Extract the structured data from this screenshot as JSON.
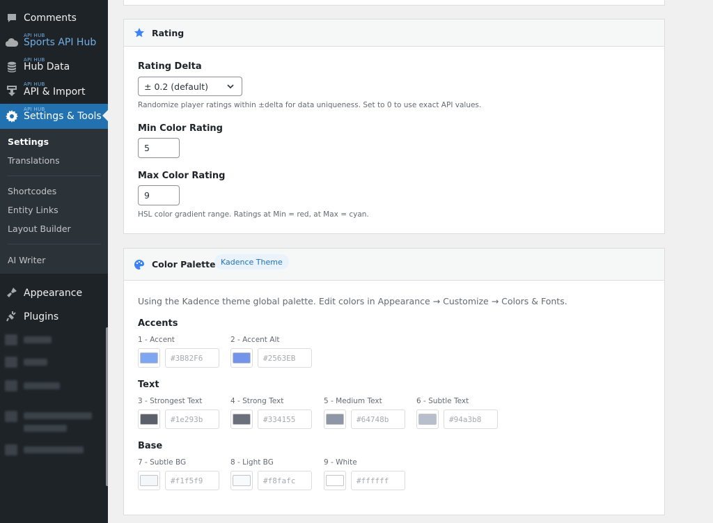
{
  "sidebar": {
    "menu": [
      {
        "label": "Comments",
        "sup": ""
      },
      {
        "label": "Sports API Hub",
        "sup": "API HUB"
      },
      {
        "label": "Hub Data",
        "sup": "API HUB"
      },
      {
        "label": "API & Import",
        "sup": "API HUB"
      },
      {
        "label": "Settings & Tools",
        "sup": "API HUB"
      }
    ],
    "submenu": [
      "Settings",
      "Translations",
      "Shortcodes",
      "Entity Links",
      "Layout Builder",
      "AI Writer"
    ],
    "lower": [
      "Appearance",
      "Plugins"
    ]
  },
  "rating": {
    "title": "Rating",
    "delta_label": "Rating Delta",
    "delta_value": "± 0.2 (default)",
    "delta_hint": "Randomize player ratings within ±delta for data uniqueness. Set to 0 to use exact API values.",
    "min_label": "Min Color Rating",
    "min_value": "5",
    "max_label": "Max Color Rating",
    "max_value": "9",
    "range_hint": "HSL color gradient range. Ratings at Min = red, at Max = cyan."
  },
  "palette": {
    "title": "Color Palette",
    "badge": "Kadence Theme",
    "intro": "Using the Kadence theme global palette. Edit colors in Appearance → Customize → Colors & Fonts.",
    "groups": [
      {
        "title": "Accents",
        "colors": [
          {
            "label": "1 - Accent",
            "hex": "#3B82F6",
            "chip": "#7fa6f0"
          },
          {
            "label": "2 - Accent Alt",
            "hex": "#2563EB",
            "chip": "#7494ec"
          }
        ]
      },
      {
        "title": "Text",
        "colors": [
          {
            "label": "3 - Strongest Text",
            "hex": "#1e293b",
            "chip": "#5c606a"
          },
          {
            "label": "4 - Strong Text",
            "hex": "#334155",
            "chip": "#6b707c"
          },
          {
            "label": "5 - Medium Text",
            "hex": "#64748b",
            "chip": "#8f97a6"
          },
          {
            "label": "6 - Subtle Text",
            "hex": "#94a3b8",
            "chip": "#b7bfcc"
          }
        ]
      },
      {
        "title": "Base",
        "colors": [
          {
            "label": "7 - Subtle BG",
            "hex": "#f1f5f9",
            "chip": "#f4f7fa"
          },
          {
            "label": "8 - Light BG",
            "hex": "#f8fafc",
            "chip": "#f8fafc"
          },
          {
            "label": "9 - White",
            "hex": "#ffffff",
            "chip": "#ffffff"
          }
        ]
      }
    ]
  }
}
